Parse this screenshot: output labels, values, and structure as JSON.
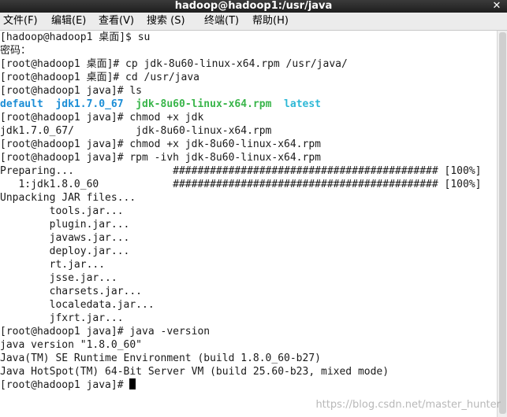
{
  "window": {
    "title": "hadoop@hadoop1:/usr/java",
    "close_glyph": "✕"
  },
  "menu": {
    "file": "文件(F)",
    "edit": "编辑(E)",
    "view": "查看(V)",
    "search": "搜索 (S)",
    "terminal": "终端(T)",
    "help": "帮助(H)"
  },
  "terminal": {
    "lines": [
      "[hadoop@hadoop1 桌面]$ su",
      "密码：",
      "[root@hadoop1 桌面]# cp jdk-8u60-linux-x64.rpm /usr/java/",
      "[root@hadoop1 桌面]# cd /usr/java",
      "[root@hadoop1 java]# ls",
      "",
      "[root@hadoop1 java]# chmod +x jdk",
      "jdk1.7.0_67/          jdk-8u60-linux-x64.rpm",
      "[root@hadoop1 java]# chmod +x jdk-8u60-linux-x64.rpm",
      "[root@hadoop1 java]# rpm -ivh jdk-8u60-linux-x64.rpm",
      "Preparing...                ########################################### [100%]",
      "   1:jdk1.8.0_60            ########################################### [100%]",
      "Unpacking JAR files...",
      "        tools.jar...",
      "        plugin.jar...",
      "        javaws.jar...",
      "        deploy.jar...",
      "        rt.jar...",
      "        jsse.jar...",
      "        charsets.jar...",
      "        localedata.jar...",
      "        jfxrt.jar...",
      "[root@hadoop1 java]# java -version",
      "java version \"1.8.0_60\"",
      "Java(TM) SE Runtime Environment (build 1.8.0_60-b27)",
      "Java HotSpot(TM) 64-Bit Server VM (build 25.60-b23, mixed mode)",
      "[root@hadoop1 java]# "
    ],
    "ls_output": {
      "default": "default",
      "jdk17": "jdk1.7.0_67",
      "rpm": "jdk-8u60-linux-x64.rpm",
      "latest": "latest"
    }
  },
  "watermark": "https://blog.csdn.net/master_hunter",
  "colors": {
    "directory": "#1c8ed6",
    "executable": "#39b54a",
    "symlink": "#2eb8d6"
  },
  "icons": {
    "close": "close-icon"
  }
}
